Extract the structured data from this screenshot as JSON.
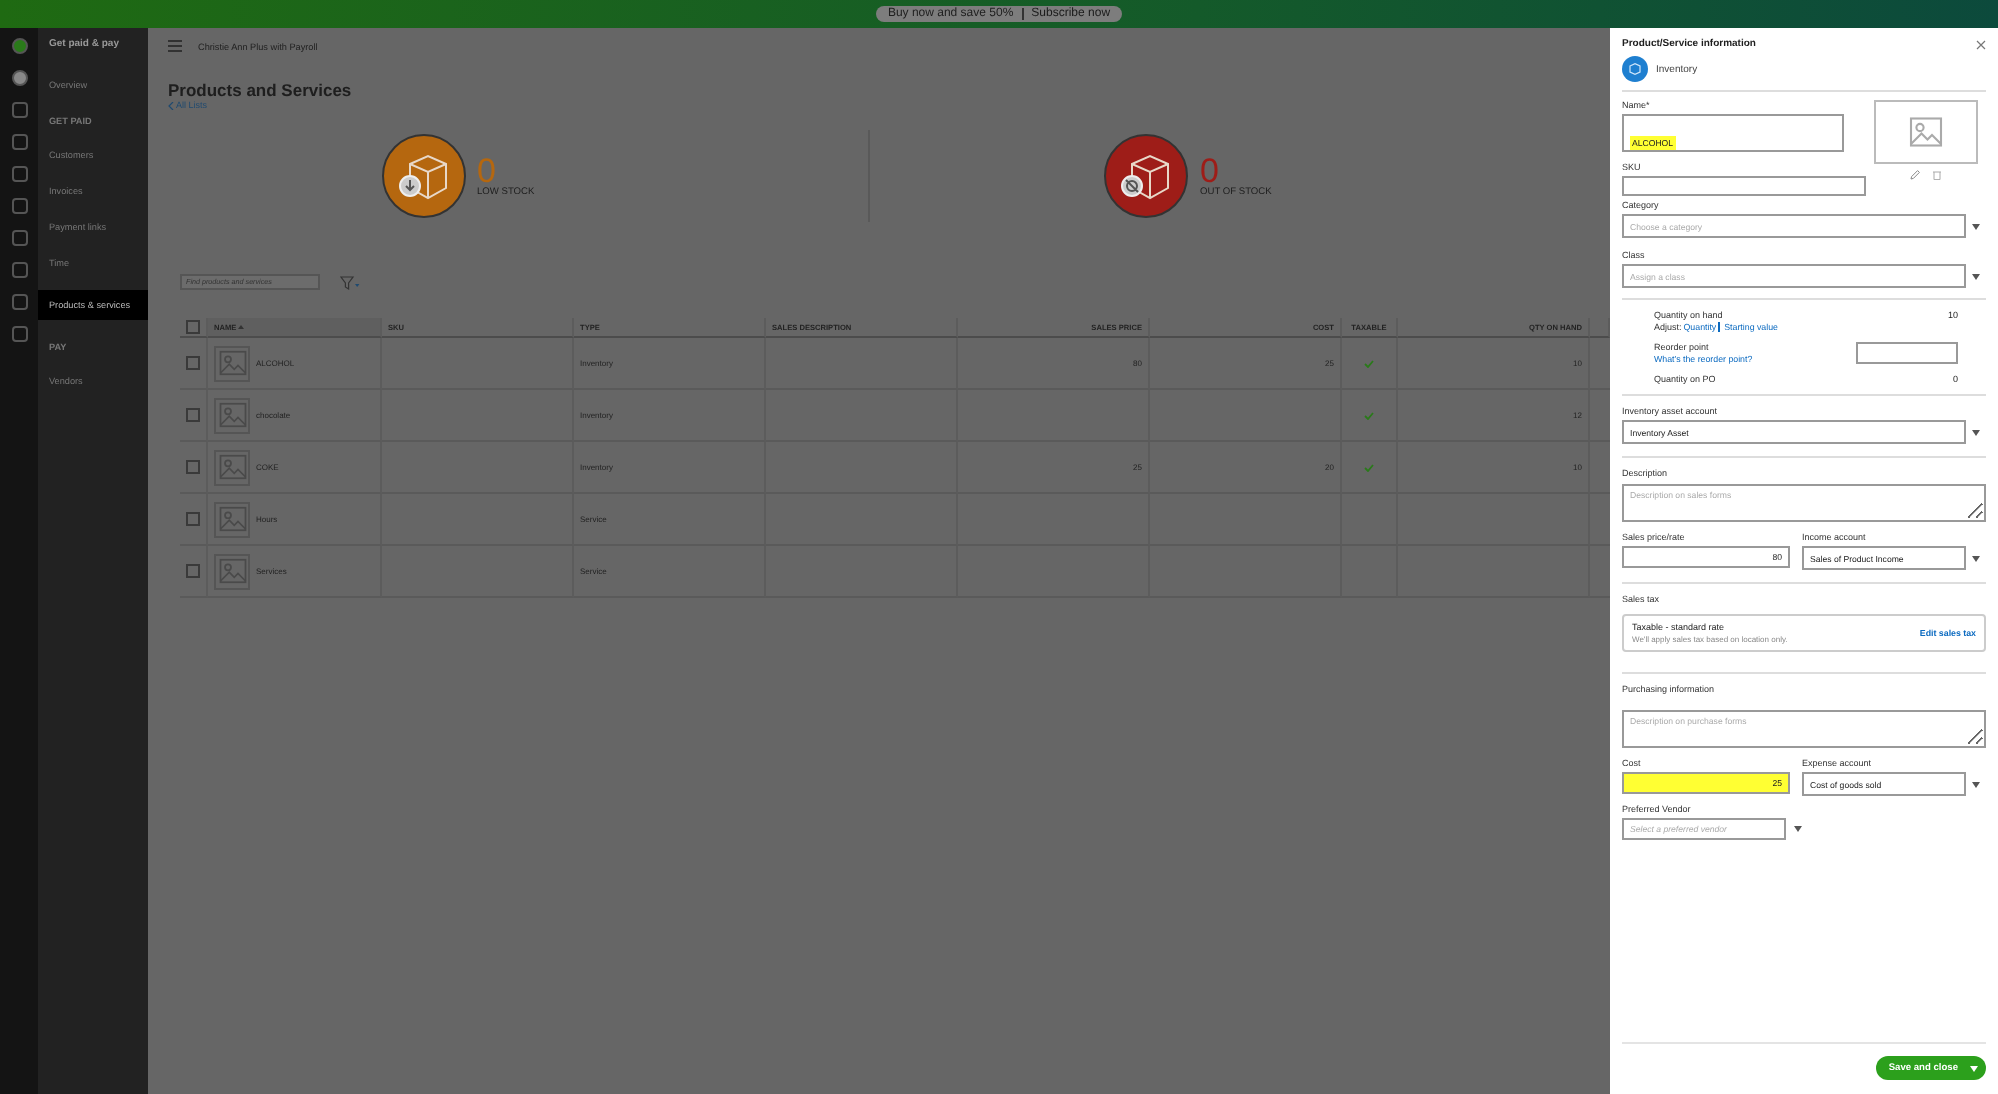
{
  "promo_bar": {
    "offer": "Buy now and save 50%",
    "action": "Subscribe now"
  },
  "sidebar": {
    "title": "Get paid & pay",
    "items": [
      {
        "kind": "link",
        "label": "Overview",
        "selected": false
      },
      {
        "kind": "section",
        "label": "GET PAID"
      },
      {
        "kind": "link",
        "label": "Customers",
        "selected": false
      },
      {
        "kind": "link",
        "label": "Invoices",
        "selected": false
      },
      {
        "kind": "link",
        "label": "Payment links",
        "selected": false
      },
      {
        "kind": "link",
        "label": "Time",
        "selected": false
      },
      {
        "kind": "link",
        "label": "Products & services",
        "selected": true
      },
      {
        "kind": "section",
        "label": "PAY"
      },
      {
        "kind": "link",
        "label": "Vendors",
        "selected": false
      }
    ]
  },
  "header": {
    "company": "Christie Ann Plus with Payroll"
  },
  "page": {
    "title": "Products and Services",
    "back_link": "All Lists"
  },
  "stock": [
    {
      "kind": "low",
      "count": "0",
      "label": "LOW STOCK",
      "color": "#b5670f"
    },
    {
      "kind": "out",
      "count": "0",
      "label": "OUT OF STOCK",
      "color": "#9e1d18"
    }
  ],
  "search": {
    "placeholder": "Find products and services"
  },
  "table": {
    "select_all": {
      "checked": false
    },
    "columns": [
      {
        "label": "NAME",
        "sorted": true
      },
      {
        "label": "SKU",
        "sorted": false
      },
      {
        "label": "TYPE",
        "sorted": false
      },
      {
        "label": "SALES DESCRIPTION",
        "sorted": false
      },
      {
        "label": "SALES PRICE",
        "sorted": false
      },
      {
        "label": "COST",
        "sorted": false
      },
      {
        "label": "TAXABLE",
        "sorted": false
      },
      {
        "label": "QTY ON HAND",
        "sorted": false
      }
    ],
    "rows": [
      {
        "name": "ALCOHOL",
        "type": "Inventory",
        "sales_price": "80",
        "cost": "25",
        "taxable": true,
        "qty_on_hand": "10",
        "selected": false
      },
      {
        "name": "chocolate",
        "type": "Inventory",
        "taxable": true,
        "qty_on_hand": "12",
        "selected": false
      },
      {
        "name": "COKE",
        "type": "Inventory",
        "sales_price": "25",
        "cost": "20",
        "taxable": true,
        "qty_on_hand": "10",
        "selected": false
      },
      {
        "name": "Hours",
        "type": "Service",
        "taxable": false,
        "selected": false
      },
      {
        "name": "Services",
        "type": "Service",
        "taxable": false,
        "selected": false
      }
    ]
  },
  "drawer": {
    "title": "Product/Service information",
    "item_type": "Inventory",
    "name": {
      "label": "Name*",
      "value": "ALCOHOL",
      "highlighted": true
    },
    "sku": {
      "label": "SKU"
    },
    "category": {
      "label": "Category",
      "placeholder": "Choose a category"
    },
    "class": {
      "label": "Class",
      "placeholder": "Assign a class"
    },
    "quantity": {
      "on_hand_label": "Quantity on hand",
      "on_hand": "10",
      "adjust_label": "Adjust:",
      "adjust_links": [
        "Quantity",
        "Starting value"
      ],
      "reorder_label": "Reorder point",
      "reorder_help": "What's the reorder point?",
      "on_po_label": "Quantity on PO",
      "on_po": "0"
    },
    "asset_account": {
      "label": "Inventory asset account",
      "value": "Inventory Asset"
    },
    "description": {
      "label": "Description",
      "placeholder": "Description on sales forms"
    },
    "sales_price": {
      "label": "Sales price/rate",
      "value": "80"
    },
    "income_account": {
      "label": "Income account",
      "value": "Sales of Product Income"
    },
    "sales_tax": {
      "label": "Sales tax",
      "title": "Taxable - standard rate",
      "note": "We'll apply sales tax based on location only.",
      "edit": "Edit sales tax"
    },
    "purchasing": {
      "label": "Purchasing information",
      "placeholder": "Description on purchase forms"
    },
    "cost": {
      "label": "Cost",
      "value": "25",
      "highlighted": true
    },
    "expense_account": {
      "label": "Expense account",
      "value": "Cost of goods sold"
    },
    "vendor": {
      "label": "Preferred Vendor",
      "placeholder": "Select a preferred vendor"
    },
    "save": "Save and close"
  }
}
